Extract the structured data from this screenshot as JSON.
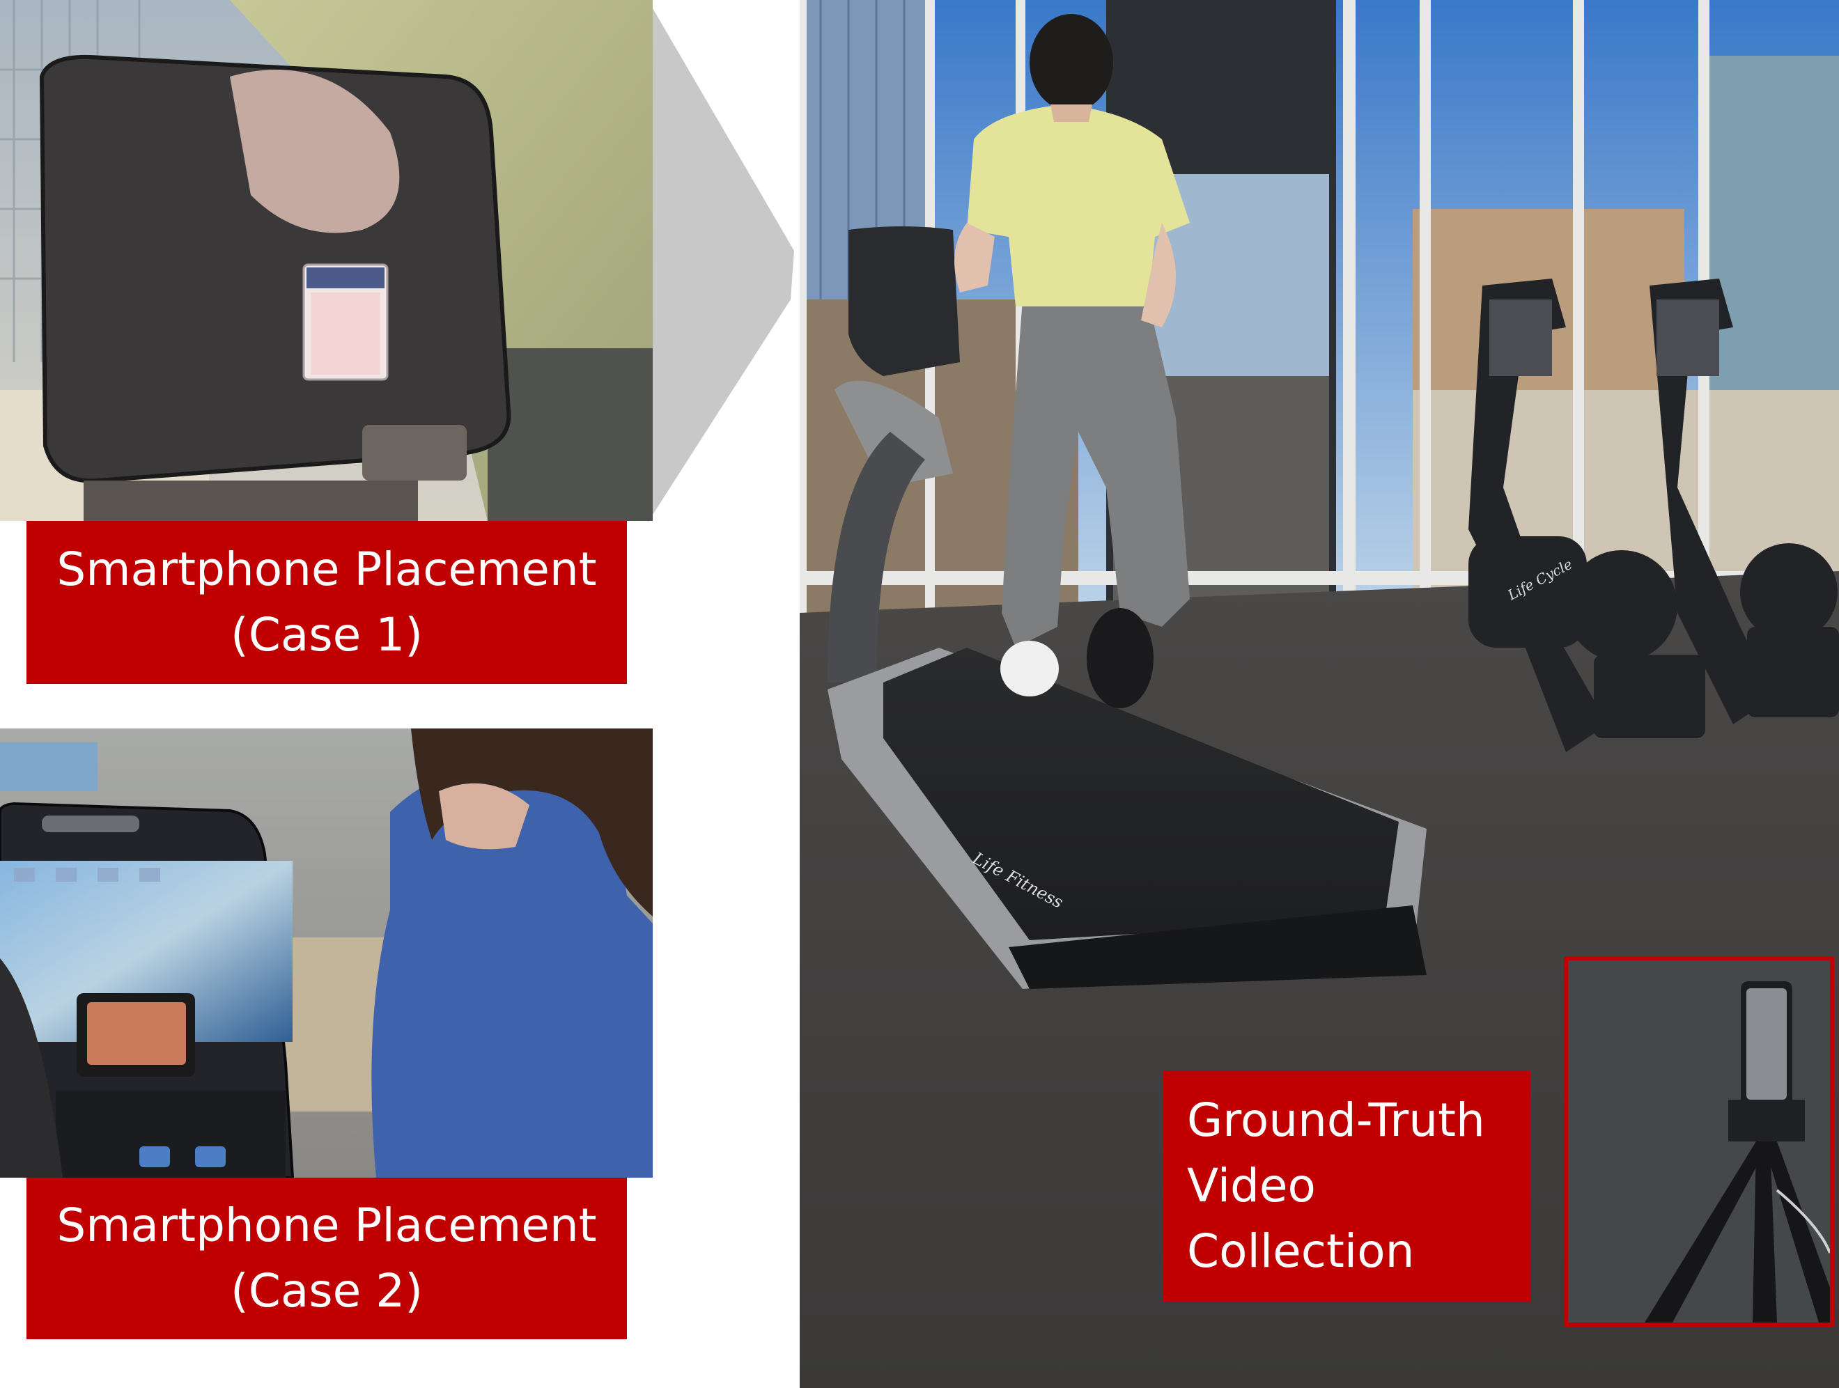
{
  "figure": {
    "panels": [
      {
        "id": "case1",
        "subject": "smartphone mounted on treadmill console, runner in yellow shirt"
      },
      {
        "id": "case2",
        "subject": "smartphone resting on treadmill display, runner in blue shirt"
      },
      {
        "id": "main",
        "subject": "person running on treadmill in gym with exercise bikes and windows"
      }
    ],
    "captions": {
      "case1": {
        "line1": "Smartphone Placement",
        "line2": "(Case 1)"
      },
      "case2": {
        "line1": "Smartphone Placement",
        "line2": "(Case 2)"
      },
      "ground_truth": {
        "line1": "Ground-Truth",
        "line2": "Video",
        "line3": "Collection"
      }
    },
    "brand_text": {
      "treadmill": "Life Fitness",
      "bike": "Life Cycle"
    },
    "colors": {
      "caption_bg": "#c00000",
      "caption_text": "#ffffff",
      "highlight_border": "#c00000",
      "zoom_wedge": "#c8c8c8"
    },
    "icons": {
      "zoom_connector": "zoom-wedge-icon",
      "highlight": "tripod-highlight-box"
    }
  }
}
